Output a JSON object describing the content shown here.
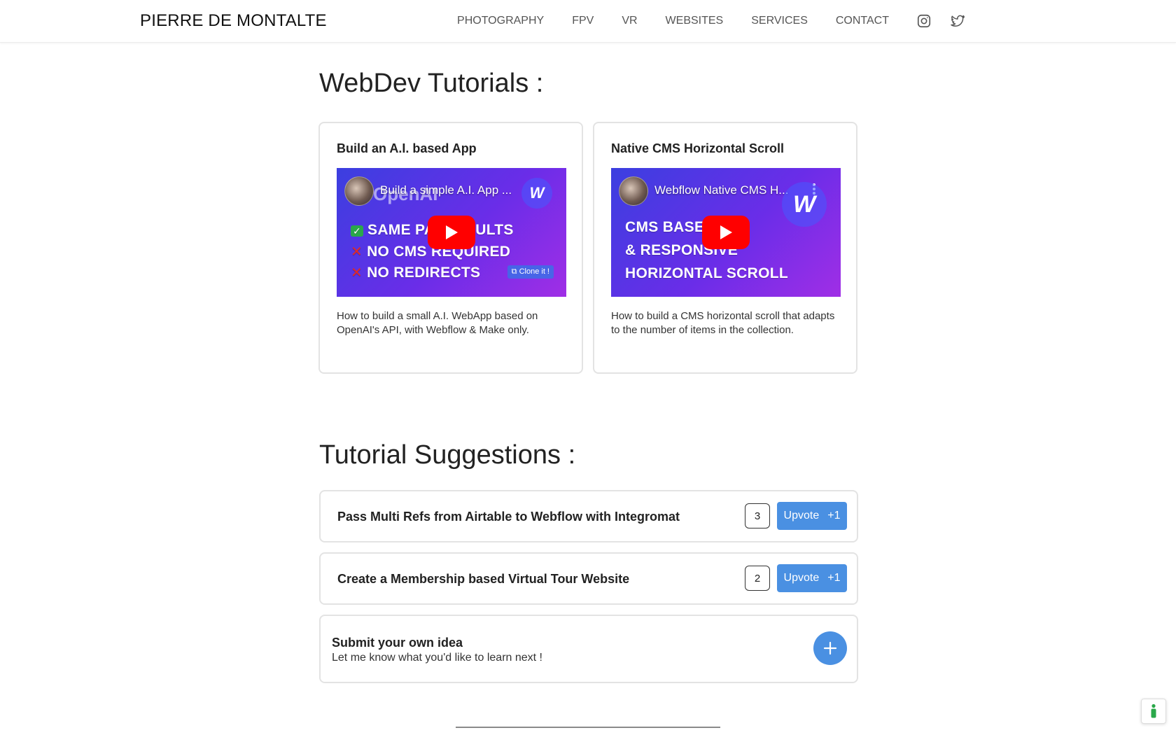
{
  "header": {
    "brand": "PIERRE DE MONTALTE",
    "nav": [
      "PHOTOGRAPHY",
      "FPV",
      "VR",
      "WEBSITES",
      "SERVICES",
      "CONTACT"
    ],
    "social_icons": [
      "instagram-icon",
      "twitter-icon"
    ]
  },
  "tutorials": {
    "heading": "WebDev Tutorials :",
    "cards": [
      {
        "title": "Build an A.I. based App",
        "video_title": "Build a simple A.I. App ...",
        "thumb_heading": "OpenAI",
        "thumb_lines": [
          "SAME PA",
          "ULTS",
          "NO CMS REQUIRED",
          "NO REDIRECTS"
        ],
        "thumb_badge": "Clone it !",
        "description": "How to build a small A.I. WebApp based on OpenAI's API, with Webflow & Make only."
      },
      {
        "title": "Native CMS Horizontal Scroll",
        "video_title": "Webflow Native CMS H...",
        "thumb_lines": [
          "CMS BASED",
          "& RESPONSIVE",
          "HORIZONTAL SCROLL"
        ],
        "description": "How to build a CMS horizontal scroll that adapts to the number of items in the collection."
      }
    ]
  },
  "suggestions": {
    "heading": "Tutorial Suggestions :",
    "items": [
      {
        "title": "Pass Multi Refs from Airtable to Webflow with Integromat",
        "votes": "3",
        "upvote_label": "Upvote",
        "upvote_plus": "+1"
      },
      {
        "title": "Create a Membership based Virtual Tour Website",
        "votes": "2",
        "upvote_label": "Upvote",
        "upvote_plus": "+1"
      }
    ],
    "submit": {
      "title": "Submit your own idea",
      "subtitle": "Let me know what you'd like to learn next !"
    }
  },
  "colors": {
    "accent": "#4a90e2",
    "youtube_red": "#ff0000",
    "card_border": "#e3e3e3"
  }
}
